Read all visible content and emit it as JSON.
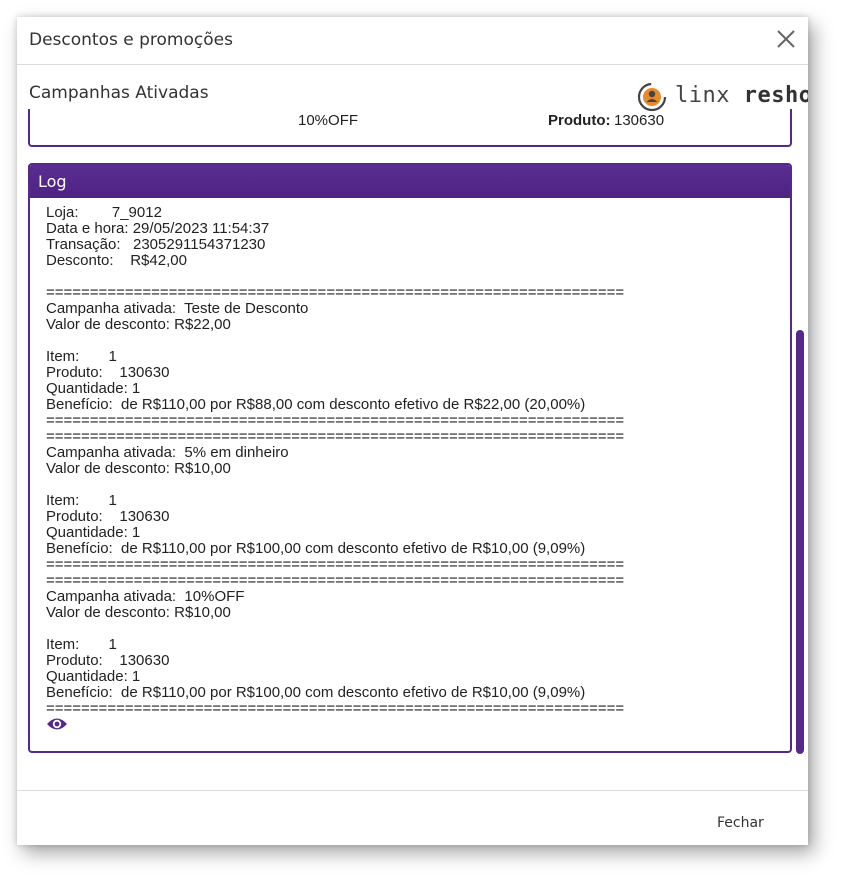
{
  "dialog": {
    "title": "Descontos e promoções",
    "close_icon": "close-icon"
  },
  "sub_header": {
    "title": "Campanhas Ativadas",
    "logo_icon": "linx-reshop-logo",
    "logo_linx": "linx",
    "logo_reshop": "reshop"
  },
  "campaign_row": {
    "name": "10%OFF",
    "product_label": "Produto:",
    "product_value": "130630"
  },
  "log": {
    "title": "Log",
    "lines": [
      "Loja:        7_9012",
      "Data e hora: 29/05/2023 11:54:37",
      "Transação:   2305291154371230",
      "Desconto:    R$42,00",
      "",
      "==================================================================",
      "Campanha ativada:  Teste de Desconto",
      "Valor de desconto: R$22,00",
      "",
      "Item:       1",
      "Produto:    130630",
      "Quantidade: 1",
      "Benefício:  de R$110,00 por R$88,00 com desconto efetivo de R$22,00 (20,00%)",
      "==================================================================",
      "==================================================================",
      "Campanha ativada:  5% em dinheiro",
      "Valor de desconto: R$10,00",
      "",
      "Item:       1",
      "Produto:    130630",
      "Quantidade: 1",
      "Benefício:  de R$110,00 por R$100,00 com desconto efetivo de R$10,00 (9,09%)",
      "==================================================================",
      "==================================================================",
      "Campanha ativada:  10%OFF",
      "Valor de desconto: R$10,00",
      "",
      "Item:       1",
      "Produto:    130630",
      "Quantidade: 1",
      "Benefício:  de R$110,00 por R$100,00 com desconto efetivo de R$10,00 (9,09%)",
      "=================================================================="
    ],
    "eye_icon": "eye-icon"
  },
  "footer": {
    "close_label": "Fechar"
  },
  "colors": {
    "accent": "#55288a",
    "logo_orange": "#e8892b"
  }
}
